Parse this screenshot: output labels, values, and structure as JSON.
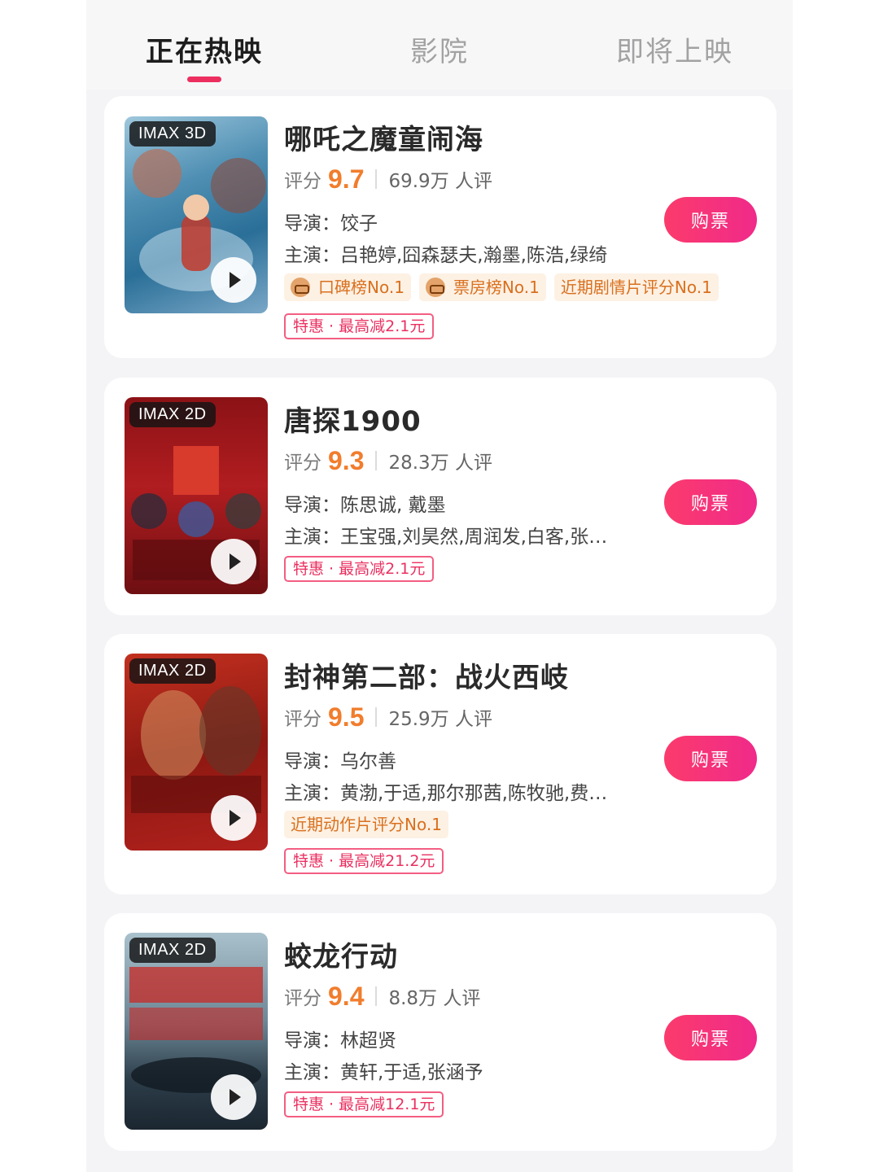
{
  "tabs": [
    {
      "label": "正在热映",
      "active": true
    },
    {
      "label": "影院",
      "active": false
    },
    {
      "label": "即将上映",
      "active": false
    }
  ],
  "labels": {
    "rating_prefix": "评分",
    "director_prefix": "导演：",
    "cast_prefix": "主演：",
    "reviews_suffix": "人评",
    "buy_button": "购票"
  },
  "movies": [
    {
      "format": "IMAX 3D",
      "title": "哪吒之魔童闹海",
      "score": "9.7",
      "review_count": "69.9万",
      "director": "饺子",
      "cast": "吕艳婷,囧森瑟夫,瀚墨,陈浩,绿绮",
      "tags": [
        {
          "text": "口碑榜No.1",
          "icon": "mascot-icon"
        },
        {
          "text": "票房榜No.1",
          "icon": "mascot-icon"
        },
        {
          "text": "近期剧情片评分No.1"
        }
      ],
      "promo": "特惠 · 最高减2.1元",
      "poster_colors": [
        "#4f8fb3",
        "#2a6f98",
        "#7aa7c7"
      ]
    },
    {
      "format": "IMAX 2D",
      "title": "唐探1900",
      "score": "9.3",
      "review_count": "28.3万",
      "director": "陈思诚, 戴墨",
      "cast": "王宝强,刘昊然,周润发,白客,张…",
      "tags": [],
      "promo": "特惠 · 最高减2.1元",
      "poster_colors": [
        "#a3171c",
        "#6e0f12",
        "#d13a2a"
      ]
    },
    {
      "format": "IMAX 2D",
      "title": "封神第二部：战火西岐",
      "score": "9.5",
      "review_count": "25.9万",
      "director": "乌尔善",
      "cast": "黄渤,于适,那尔那茜,陈牧驰,费…",
      "tags": [
        {
          "text": "近期动作片评分No.1"
        }
      ],
      "promo": "特惠 · 最高减21.2元",
      "poster_colors": [
        "#b0211c",
        "#7a1410",
        "#d04828"
      ]
    },
    {
      "format": "IMAX 2D",
      "title": "蛟龙行动",
      "score": "9.4",
      "review_count": "8.8万",
      "director": "林超贤",
      "cast": "黄轩,于适,张涵予",
      "tags": [],
      "promo": "特惠 · 最高减12.1元",
      "poster_colors": [
        "#8fa9b6",
        "#3d5363",
        "#22303a"
      ]
    }
  ],
  "colors": {
    "accent": "#ec2f5f",
    "score": "#f17d2d",
    "buy_gradient": [
      "#fb3b6c",
      "#f02a8a"
    ]
  }
}
